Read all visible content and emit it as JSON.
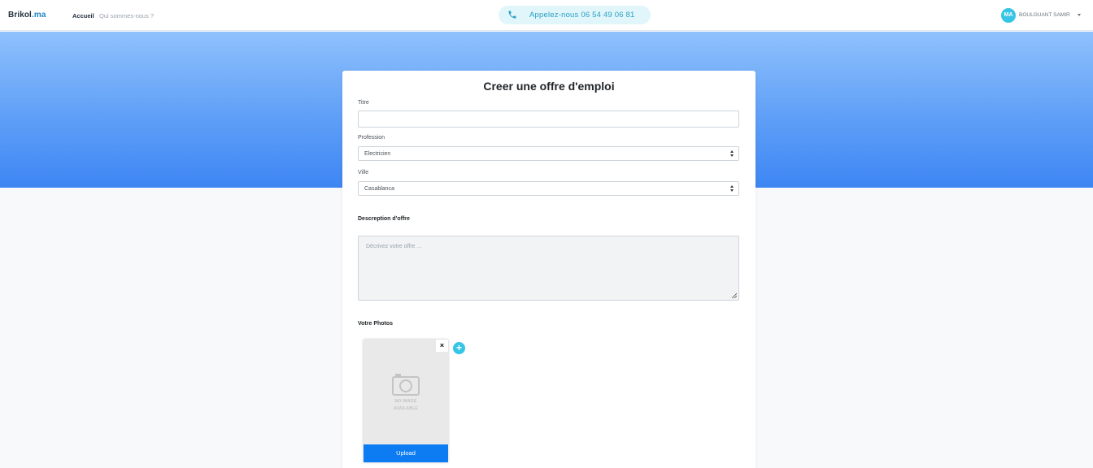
{
  "navbar": {
    "brand_main": "Brikol",
    "brand_dot": ".ma",
    "links": [
      {
        "label": "Accueil"
      },
      {
        "label": "Qui sommes-nous ?"
      }
    ],
    "call_label": "Appelez-nous 06 54 49 06 81",
    "user_initials": "MA",
    "user_name": "BOULGUANT SAMIR"
  },
  "form": {
    "title": "Creer une offre d'emploi",
    "titre_label": "Titre",
    "titre_value": "",
    "profession_label": "Profession",
    "profession_value": "Electricien",
    "ville_label": "Ville",
    "ville_value": "Casablanca",
    "description_label": "Descreption d'offre",
    "description_placeholder": "Décrivez votre offre ...",
    "photos_label": "Votre Photos",
    "no_image_line1": "NO IMAGE",
    "no_image_line2": "AVAILABLE",
    "remove_label": "×",
    "upload_label": "Upload",
    "add_label": "+"
  },
  "colors": {
    "accent": "#37c5e6",
    "upload": "#0d7cf2",
    "hero_top": "#8fc1fc",
    "hero_bottom": "#3d86f3"
  }
}
